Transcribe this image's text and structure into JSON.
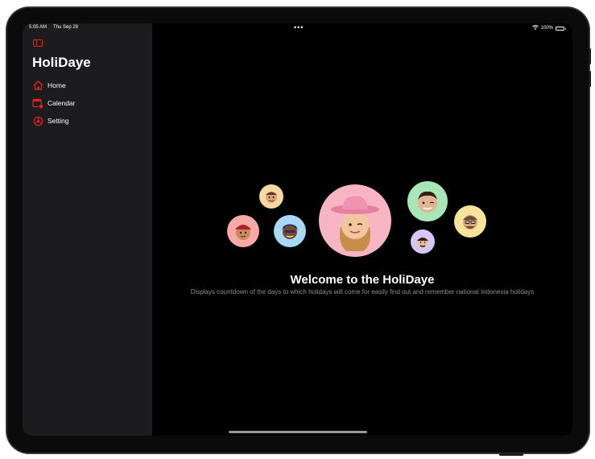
{
  "status_bar": {
    "time": "5:05 AM",
    "date": "Thu Sep 28",
    "dots": "•••",
    "battery": "100%"
  },
  "sidebar": {
    "title": "HoliDaye",
    "items": [
      {
        "label": "Home",
        "icon": "house-icon"
      },
      {
        "label": "Calendar",
        "icon": "calendar-badge-icon"
      },
      {
        "label": "Setting",
        "icon": "gear-icon"
      }
    ]
  },
  "main": {
    "welcome": "Welcome to the HoliDaye",
    "description": "Displays countdown of the days to which holidays will come for easily find out and remember national Indonesia holidays"
  },
  "colors": {
    "accent": "#e0241b",
    "sidebar_bg": "#1c1c1e",
    "background": "#000000"
  }
}
